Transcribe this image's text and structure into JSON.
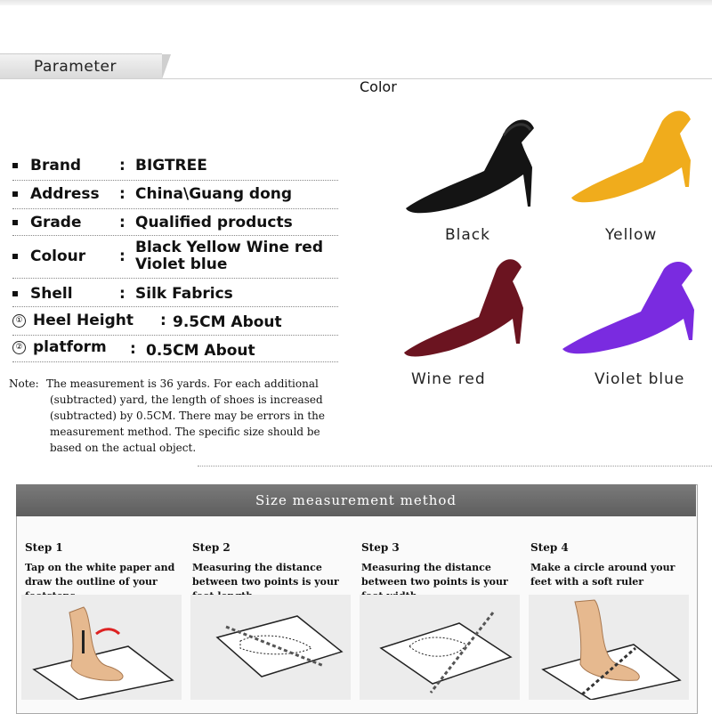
{
  "header": {
    "parameter_label": "Parameter",
    "color_label": "Color"
  },
  "specs": [
    {
      "label": "Brand",
      "value": "BIGTREE",
      "marker": "bullet"
    },
    {
      "label": "Address",
      "value": "China\\Guang dong",
      "marker": "bullet"
    },
    {
      "label": "Grade",
      "value": "Qualified products",
      "marker": "bullet"
    },
    {
      "label": "Colour",
      "value": "Black  Yellow  Wine red",
      "value2": "Violet blue",
      "marker": "bullet"
    },
    {
      "label": "Shell",
      "value": "Silk Fabrics",
      "marker": "bullet"
    },
    {
      "label": "Heel  Height",
      "value": "9.5CM About",
      "marker": "①"
    },
    {
      "label": "platform",
      "value": "0.5CM About",
      "marker": "②"
    }
  ],
  "note": {
    "lead": "Note:",
    "lines": [
      "The measurement is 36 yards. For each additional",
      "(subtracted) yard, the length of shoes is increased",
      "(subtracted) by 0.5CM. There may be errors in the",
      "measurement method. The specific size should be",
      "based on the actual object."
    ]
  },
  "colors": [
    {
      "name": "Black",
      "hex": "#141414"
    },
    {
      "name": "Yellow",
      "hex": "#f0ac1c"
    },
    {
      "name": "Wine red",
      "hex": "#6b1420"
    },
    {
      "name": "Violet blue",
      "hex": "#7a2be0"
    }
  ],
  "size_section": {
    "title": "Size measurement method",
    "steps": [
      {
        "title": "Step 1",
        "desc": "Tap on the white paper and draw the outline of your footsteps"
      },
      {
        "title": "Step 2",
        "desc": "Measuring the distance between two points is your foot length."
      },
      {
        "title": "Step 3",
        "desc": "Measuring the distance between two points is your foot width."
      },
      {
        "title": "Step 4",
        "desc": "Make a circle around your feet with a soft ruler"
      }
    ]
  }
}
